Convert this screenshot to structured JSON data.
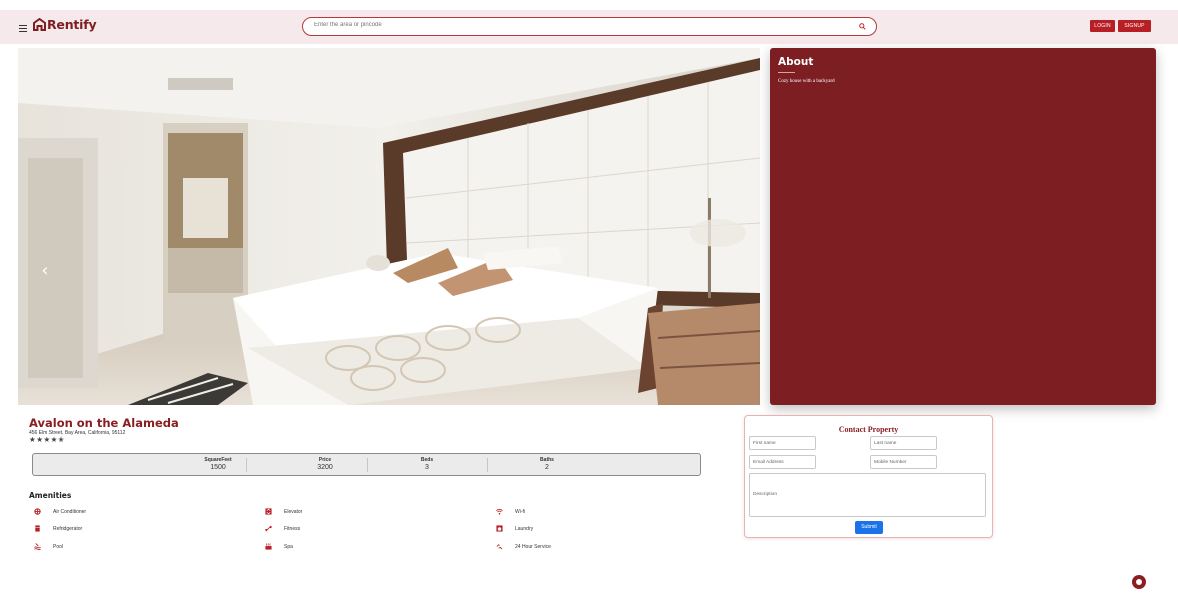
{
  "header": {
    "logo_text": "Rentify",
    "search_placeholder": "Enter the area or pincode",
    "login_label": "LOGIN",
    "signup_label": "SIGNUP"
  },
  "colors": {
    "brand": "#7d1f22",
    "header_bg": "#f6e9ec",
    "button_red": "#b81f24",
    "submit_blue": "#1a73e8"
  },
  "gallery": {
    "prev_icon": "chevron-left-icon",
    "next_icon": "chevron-right-icon"
  },
  "about": {
    "title": "About",
    "description": "Cozy house with a backyard"
  },
  "property": {
    "name": "Avalon on the Alameda",
    "address": "456 Elm Street, Bay Area, California, 95112",
    "rating": "★★★★✬",
    "stats": [
      {
        "label": "SquareFeet",
        "value": "1500"
      },
      {
        "label": "Price",
        "value": "3200"
      },
      {
        "label": "Beds",
        "value": "3"
      },
      {
        "label": "Baths",
        "value": "2"
      }
    ]
  },
  "amenities": {
    "title": "Amenities",
    "items": [
      {
        "label": "Air Conditioner",
        "icon": "air-conditioner-icon"
      },
      {
        "label": "Elevator",
        "icon": "elevator-icon"
      },
      {
        "label": "Wi-fi",
        "icon": "wifi-icon"
      },
      {
        "label": "Refridgerator",
        "icon": "refrigerator-icon"
      },
      {
        "label": "Fitness",
        "icon": "fitness-icon"
      },
      {
        "label": "Laundry",
        "icon": "laundry-icon"
      },
      {
        "label": "Pool",
        "icon": "pool-icon"
      },
      {
        "label": "Spa",
        "icon": "spa-icon"
      },
      {
        "label": "24 Hour Service",
        "icon": "service-icon"
      }
    ]
  },
  "contact": {
    "title": "Contact Property",
    "first_name_placeholder": "First name",
    "last_name_placeholder": "Last name",
    "email_placeholder": "Email Address",
    "mobile_placeholder": "Mobile Number",
    "description_placeholder": "Description",
    "submit_label": "Submit"
  }
}
